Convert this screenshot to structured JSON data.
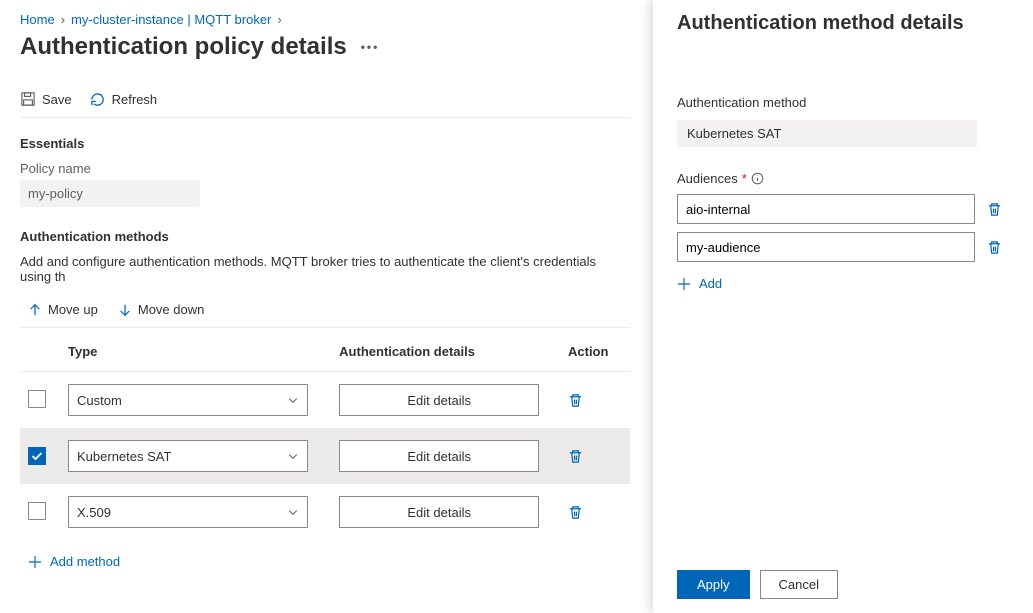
{
  "breadcrumb": {
    "home": "Home",
    "cluster": "my-cluster-instance | MQTT broker"
  },
  "page": {
    "title": "Authentication policy details"
  },
  "toolbar": {
    "save": "Save",
    "refresh": "Refresh"
  },
  "essentials": {
    "heading": "Essentials",
    "policy_name_label": "Policy name",
    "policy_name_value": "my-policy"
  },
  "methods": {
    "heading": "Authentication methods",
    "description": "Add and configure authentication methods. MQTT broker tries to authenticate the client's credentials using th",
    "move_up": "Move up",
    "move_down": "Move down",
    "col_type": "Type",
    "col_details": "Authentication details",
    "col_action": "Action",
    "edit_text": "Edit details",
    "rows": [
      {
        "type": "Custom",
        "checked": false
      },
      {
        "type": "Kubernetes SAT",
        "checked": true
      },
      {
        "type": "X.509",
        "checked": false
      }
    ],
    "add": "Add method"
  },
  "panel": {
    "title": "Authentication method details",
    "auth_method_label": "Authentication method",
    "auth_method_value": "Kubernetes SAT",
    "audiences_label": "Audiences",
    "audiences": [
      "aio-internal",
      "my-audience"
    ],
    "add": "Add",
    "apply": "Apply",
    "cancel": "Cancel"
  }
}
